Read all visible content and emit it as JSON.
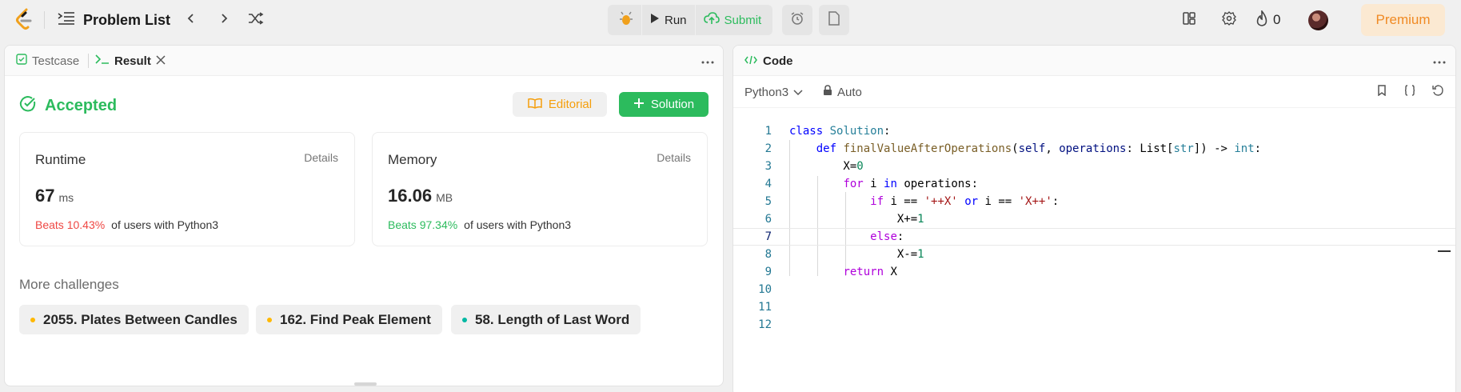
{
  "topbar": {
    "problem_list_label": "Problem List",
    "run_label": "Run",
    "submit_label": "Submit",
    "streak_count": "0",
    "premium_label": "Premium"
  },
  "left_panel": {
    "tabs": [
      {
        "label": "Testcase"
      },
      {
        "label": "Result"
      }
    ],
    "status": "Accepted",
    "editorial_label": "Editorial",
    "solution_label": "Solution",
    "runtime": {
      "title": "Runtime",
      "details_label": "Details",
      "value": "67",
      "unit": "ms",
      "beats": "Beats 10.43%",
      "beats_suffix": "of users with Python3"
    },
    "memory": {
      "title": "Memory",
      "details_label": "Details",
      "value": "16.06",
      "unit": "MB",
      "beats": "Beats 97.34%",
      "beats_suffix": "of users with Python3"
    },
    "more_challenges_title": "More challenges",
    "challenges": [
      {
        "label": "2055. Plates Between Candles",
        "color": "#ffb800"
      },
      {
        "label": "162. Find Peak Element",
        "color": "#ffb800"
      },
      {
        "label": "58. Length of Last Word",
        "color": "#00b8a3"
      }
    ]
  },
  "code_panel": {
    "tab_label": "Code",
    "language": "Python3",
    "mode": "Auto",
    "line_numbers": [
      "1",
      "2",
      "3",
      "4",
      "5",
      "6",
      "7",
      "8",
      "9",
      "10",
      "11",
      "12"
    ],
    "code_lines": [
      "class Solution:",
      "    def finalValueAfterOperations(self, operations: List[str]) -> int:",
      "        X=0",
      "        for i in operations:",
      "            if i == '++X' or i == 'X++':",
      "                X+=1",
      "            else:",
      "                X-=1",
      "        return X",
      "",
      "",
      ""
    ]
  },
  "colors": {
    "accent_green": "#2cbb5d",
    "premium_orange": "#f08a24",
    "editorial_orange": "#f59e0b",
    "beats_red": "#ef4743"
  },
  "icons": [
    "logo-icon",
    "list-icon",
    "chevron-left-icon",
    "chevron-right-icon",
    "shuffle-icon",
    "debug-icon",
    "play-icon",
    "cloud-upload-icon",
    "alarm-icon",
    "note-icon",
    "layout-icon",
    "gear-icon",
    "fire-icon",
    "check-square-icon",
    "terminal-icon",
    "close-icon",
    "check-circle-icon",
    "book-icon",
    "plus-icon",
    "code-icon",
    "chevron-down-icon",
    "lock-icon",
    "bookmark-icon",
    "braces-icon",
    "reset-icon"
  ]
}
